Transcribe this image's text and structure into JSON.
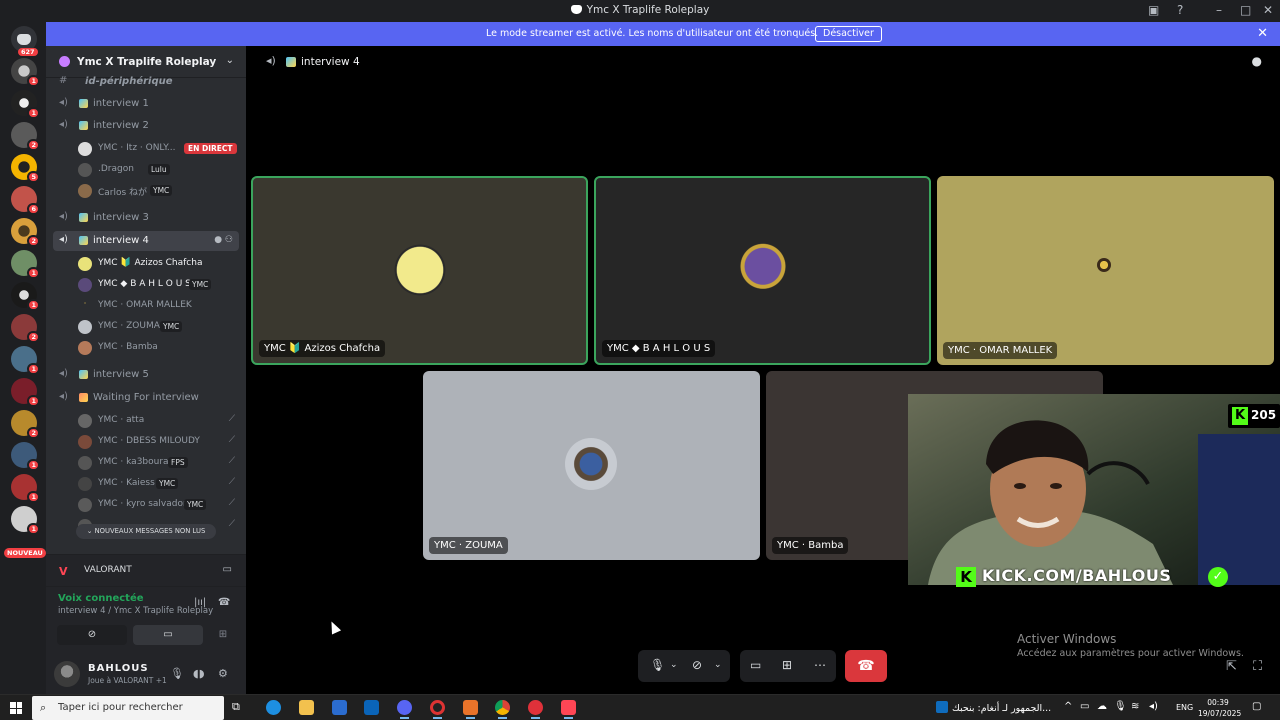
{
  "window": {
    "title": "Ymc X Traplife Roleplay"
  },
  "banner": {
    "message": "Le mode streamer est activé. Les noms d'utilisateur ont été tronqués.",
    "button": "Désactiver"
  },
  "rail": {
    "home_count": "627",
    "new_label": "NOUVEAU",
    "badges": [
      "1",
      "1",
      "2",
      "5",
      "6",
      "2",
      "1",
      "1",
      "2",
      "1",
      "1",
      "2",
      "1",
      "1",
      "1",
      "1"
    ]
  },
  "server": {
    "name": "Ymc X Traplife Roleplay"
  },
  "channels": {
    "top_partial": "id-périphérique",
    "interview1": "interview 1",
    "interview2": "interview 2",
    "interview3": "interview 3",
    "interview4": "interview 4",
    "interview5": "interview 5",
    "waiting": "Waiting For interview"
  },
  "users": {
    "u1": "YMC · Itz · ONLY...",
    "u1_live": "EN DIRECT",
    "u2": ".Dragon",
    "u2_tag": "Lulu",
    "u3": "Carlos ねが",
    "u3_tag": "YMC",
    "i4_1": "YMC 🔰 Azizos Chafcha",
    "i4_2": "YMC ◆ B A H L O U S",
    "i4_2_tag": "YMC",
    "i4_3": "YMC · OMAR MALLEK",
    "i4_4": "YMC · ZOUMA",
    "i4_4_tag": "YMC",
    "i4_5": "YMC · Bamba",
    "w1": "YMC · atta",
    "w2": "YMC · DBESS MILOUDY",
    "w3": "YMC · ka3boura",
    "w3_tag": "FPS",
    "w4": "YMC · Kaiess",
    "w4_tag": "YMC",
    "w5": "YMC · kyro salvador",
    "w5_tag": "YMC"
  },
  "new_messages": "NOUVEAUX MESSAGES NON LUS",
  "activity": {
    "game": "VALORANT"
  },
  "voice": {
    "status": "Voix connectée",
    "channel": "interview 4 / Ymc X Traplife Roleplay"
  },
  "me": {
    "name": "BAHLOUS",
    "status": "Joue à VALORANT +1"
  },
  "main": {
    "channel": "interview 4"
  },
  "tiles": [
    {
      "name": "YMC 🔰 Azizos Chafcha"
    },
    {
      "name": "YMC ◆ B A H L O U S"
    },
    {
      "name": "YMC · OMAR MALLEK"
    },
    {
      "name": "YMC · ZOUMA"
    },
    {
      "name": "YMC · Bamba"
    }
  ],
  "stream": {
    "viewers": "205",
    "url": "KICK.COM/BAHLOUS"
  },
  "windows": {
    "activate_title": "Activer Windows",
    "activate_sub": "Accédez aux paramètres pour activer Windows."
  },
  "taskbar": {
    "search_placeholder": "Taper ici pour rechercher",
    "news": "الجمهور لـ أنغام: بنحبك...",
    "lang": "ENG",
    "time": "00:39",
    "date": "19/07/2025"
  },
  "colors": {
    "blurple": "#5865f2",
    "speaking": "#3ba55d",
    "danger": "#da373c",
    "kick": "#53fc18"
  }
}
